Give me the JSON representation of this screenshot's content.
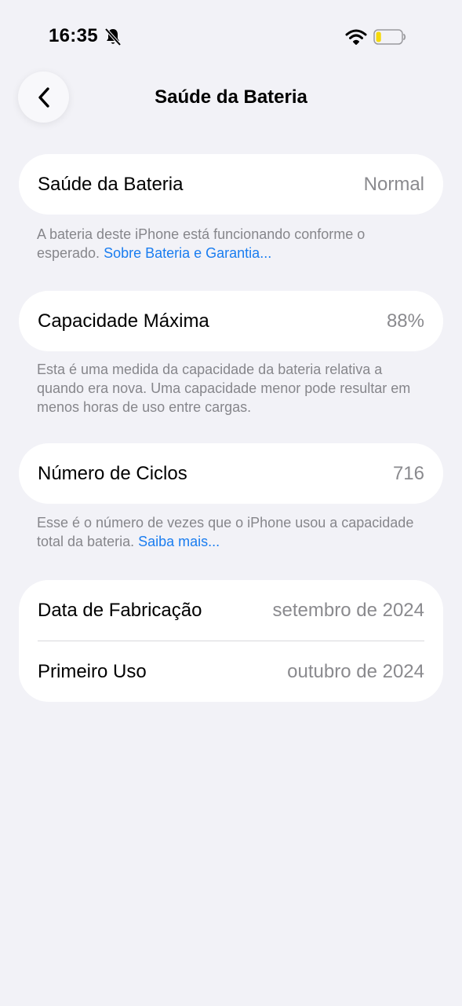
{
  "status_bar": {
    "time": "16:35",
    "battery_level": 0.2,
    "battery_color": "#f5d90a"
  },
  "nav": {
    "title": "Saúde da Bateria"
  },
  "sections": {
    "health": {
      "label": "Saúde da Bateria",
      "value": "Normal",
      "note": "A bateria deste iPhone está funcionando conforme o esperado.",
      "link": "Sobre Bateria e Garantia..."
    },
    "capacity": {
      "label": "Capacidade Máxima",
      "value": "88%",
      "note": "Esta é uma medida da capacidade da bateria relativa a quando era nova. Uma capacidade menor pode resultar em menos horas de uso entre cargas."
    },
    "cycles": {
      "label": "Número de Ciclos",
      "value": "716",
      "note": "Esse é o número de vezes que o iPhone usou a capacidade total da bateria.",
      "link": "Saiba mais..."
    },
    "dates": {
      "manufacture_label": "Data de Fabricação",
      "manufacture_value": "setembro de 2024",
      "first_use_label": "Primeiro Uso",
      "first_use_value": "outubro de 2024"
    }
  },
  "colors": {
    "background": "#f2f2f7",
    "link": "#1a7df0",
    "secondary_text": "#8a8a8e"
  },
  "icons": {
    "mute": "bell-slash-icon",
    "wifi": "wifi-icon",
    "battery": "battery-icon",
    "back": "chevron-left-icon"
  }
}
